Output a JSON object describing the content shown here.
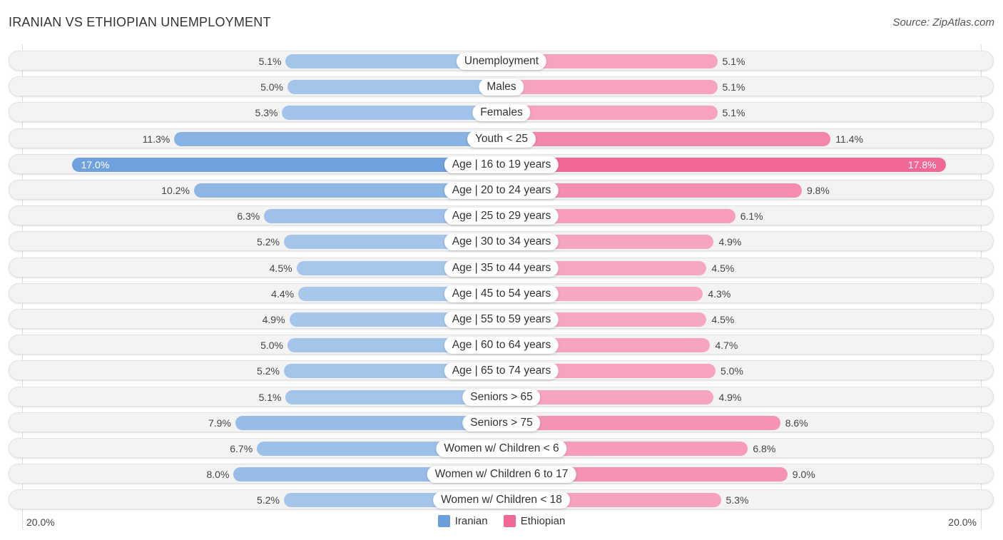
{
  "header": {
    "title": "IRANIAN VS ETHIOPIAN UNEMPLOYMENT",
    "source": "Source: ZipAtlas.com"
  },
  "colors": {
    "iranian_strong": "#6a9fdc",
    "iranian_light": "#a9c8eb",
    "ethiopian_strong": "#f26895",
    "ethiopian_light": "#f7a8c1"
  },
  "chart_data": {
    "type": "bar",
    "orientation": "horizontal-diverging",
    "title": "IRANIAN VS ETHIOPIAN UNEMPLOYMENT",
    "categories": [
      "Unemployment",
      "Males",
      "Females",
      "Youth < 25",
      "Age | 16 to 19 years",
      "Age | 20 to 24 years",
      "Age | 25 to 29 years",
      "Age | 30 to 34 years",
      "Age | 35 to 44 years",
      "Age | 45 to 54 years",
      "Age | 55 to 59 years",
      "Age | 60 to 64 years",
      "Age | 65 to 74 years",
      "Seniors > 65",
      "Seniors > 75",
      "Women w/ Children < 6",
      "Women w/ Children 6 to 17",
      "Women w/ Children < 18"
    ],
    "series": [
      {
        "name": "Iranian",
        "side": "left",
        "values": [
          5.1,
          5.0,
          5.3,
          11.3,
          17.0,
          10.2,
          6.3,
          5.2,
          4.5,
          4.4,
          4.9,
          5.0,
          5.2,
          5.1,
          7.9,
          6.7,
          8.0,
          5.2
        ],
        "labels": [
          "5.1%",
          "5.0%",
          "5.3%",
          "11.3%",
          "17.0%",
          "10.2%",
          "6.3%",
          "5.2%",
          "4.5%",
          "4.4%",
          "4.9%",
          "5.0%",
          "5.2%",
          "5.1%",
          "7.9%",
          "6.7%",
          "8.0%",
          "5.2%"
        ]
      },
      {
        "name": "Ethiopian",
        "side": "right",
        "values": [
          5.1,
          5.1,
          5.1,
          11.4,
          17.8,
          9.8,
          6.1,
          4.9,
          4.5,
          4.3,
          4.5,
          4.7,
          5.0,
          4.9,
          8.6,
          6.8,
          9.0,
          5.3
        ],
        "labels": [
          "5.1%",
          "5.1%",
          "5.1%",
          "11.4%",
          "17.8%",
          "9.8%",
          "6.1%",
          "4.9%",
          "4.5%",
          "4.3%",
          "4.5%",
          "4.7%",
          "5.0%",
          "4.9%",
          "8.6%",
          "6.8%",
          "9.0%",
          "5.3%"
        ]
      }
    ],
    "axis": {
      "min_label": "20.0%",
      "max_label": "20.0%",
      "range": [
        0,
        20
      ]
    },
    "legend": {
      "position": "bottom-center",
      "items": [
        "Iranian",
        "Ethiopian"
      ]
    },
    "unit": "%"
  }
}
